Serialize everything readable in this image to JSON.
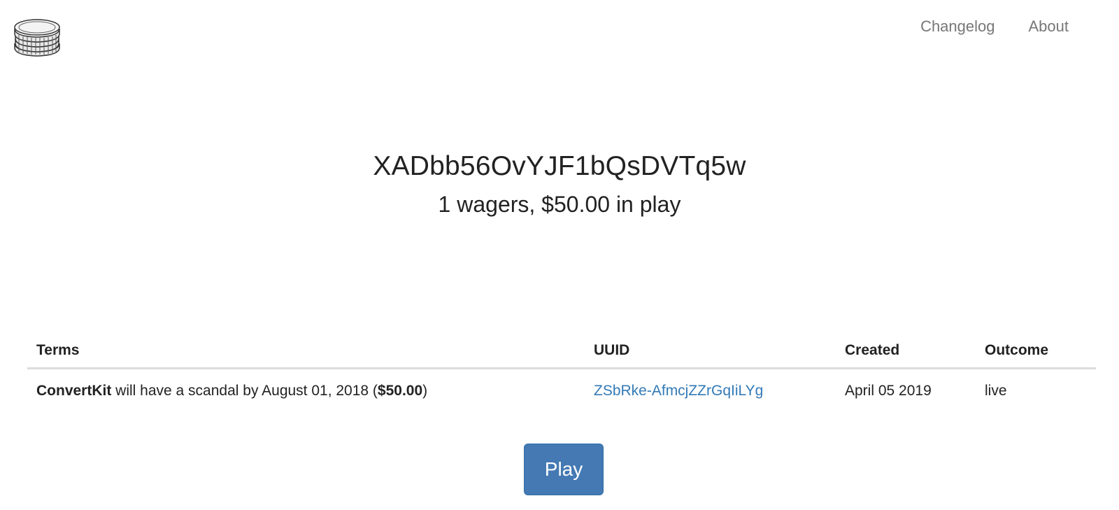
{
  "nav": {
    "changelog_label": "Changelog",
    "about_label": "About"
  },
  "hero": {
    "id": "XADbb56OvYJF1bQsDVTq5w",
    "summary": "1 wagers, $50.00 in play"
  },
  "table": {
    "headers": {
      "terms": "Terms",
      "uuid": "UUID",
      "created": "Created",
      "outcome": "Outcome"
    },
    "rows": [
      {
        "subject": "ConvertKit",
        "description": " will have a scandal by August 01, 2018 (",
        "amount": "$50.00",
        "closing": ")",
        "uuid": "ZSbRke-AfmcjZZrGqIiLYg",
        "created": "April 05 2019",
        "outcome": "live"
      }
    ]
  },
  "play_label": "Play",
  "logo_icon": "coin-stack-icon"
}
